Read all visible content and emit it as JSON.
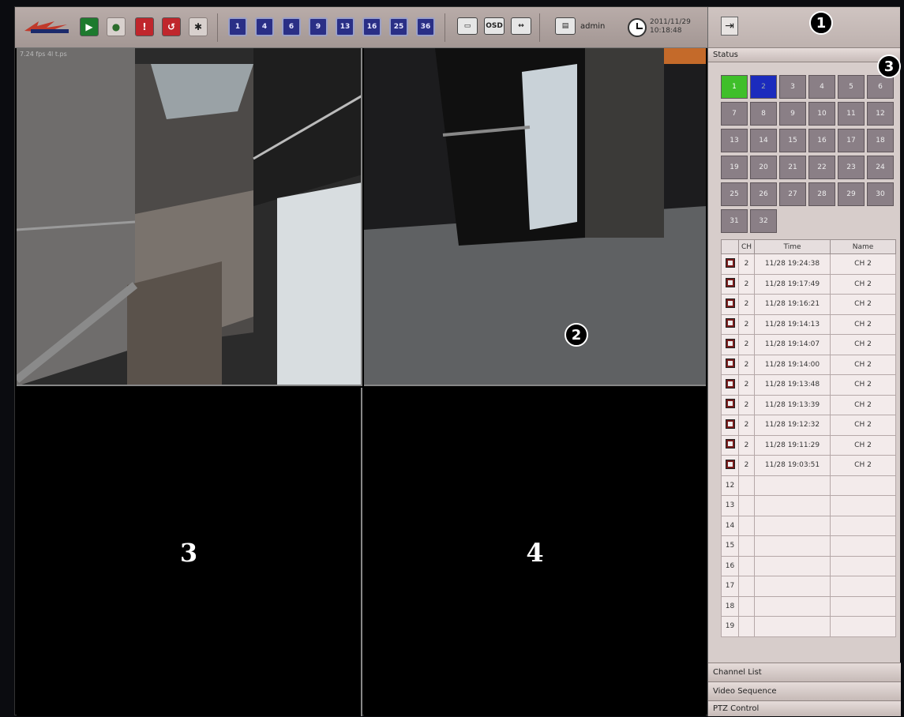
{
  "toolbar": {
    "user": "admin",
    "date": "2011/11/29",
    "time": "10:18:48",
    "osd_label": "OSD",
    "layout_buttons": [
      "1",
      "4",
      "6",
      "9",
      "13",
      "16",
      "25",
      "36"
    ],
    "icons": [
      "monitor-icon",
      "location-pin-icon",
      "alarm-icon",
      "event-search-icon",
      "settings-gear-icon"
    ]
  },
  "video": {
    "fps_label": "7.24 fps   4l t.ps",
    "cells": [
      {
        "label": ""
      },
      {
        "label": ""
      },
      {
        "label": "3"
      },
      {
        "label": "4"
      }
    ]
  },
  "panel": {
    "status_label": "Status",
    "channels": [
      "1",
      "2",
      "3",
      "4",
      "5",
      "6",
      "7",
      "8",
      "9",
      "10",
      "11",
      "12",
      "13",
      "14",
      "15",
      "16",
      "17",
      "18",
      "19",
      "20",
      "21",
      "22",
      "23",
      "24",
      "25",
      "26",
      "27",
      "28",
      "29",
      "30",
      "31",
      "32"
    ],
    "active_green": "1",
    "active_blue": "2",
    "table": {
      "headers": [
        "",
        "CH",
        "Time",
        "Name"
      ],
      "rows": [
        {
          "ch": "2",
          "time": "11/28 19:24:38",
          "name": "CH 2"
        },
        {
          "ch": "2",
          "time": "11/28 19:17:49",
          "name": "CH 2"
        },
        {
          "ch": "2",
          "time": "11/28 19:16:21",
          "name": "CH 2"
        },
        {
          "ch": "2",
          "time": "11/28 19:14:13",
          "name": "CH 2"
        },
        {
          "ch": "2",
          "time": "11/28 19:14:07",
          "name": "CH 2"
        },
        {
          "ch": "2",
          "time": "11/28 19:14:00",
          "name": "CH 2"
        },
        {
          "ch": "2",
          "time": "11/28 19:13:48",
          "name": "CH 2"
        },
        {
          "ch": "2",
          "time": "11/28 19:13:39",
          "name": "CH 2"
        },
        {
          "ch": "2",
          "time": "11/28 19:12:32",
          "name": "CH 2"
        },
        {
          "ch": "2",
          "time": "11/28 19:11:29",
          "name": "CH 2"
        },
        {
          "ch": "2",
          "time": "11/28 19:03:51",
          "name": "CH 2"
        }
      ],
      "empty_rows": [
        "12",
        "13",
        "14",
        "15",
        "16",
        "17",
        "18",
        "19"
      ]
    },
    "accordion": [
      "Channel List",
      "Video Sequence",
      "PTZ Control"
    ]
  },
  "callouts": [
    "1",
    "2",
    "3"
  ]
}
